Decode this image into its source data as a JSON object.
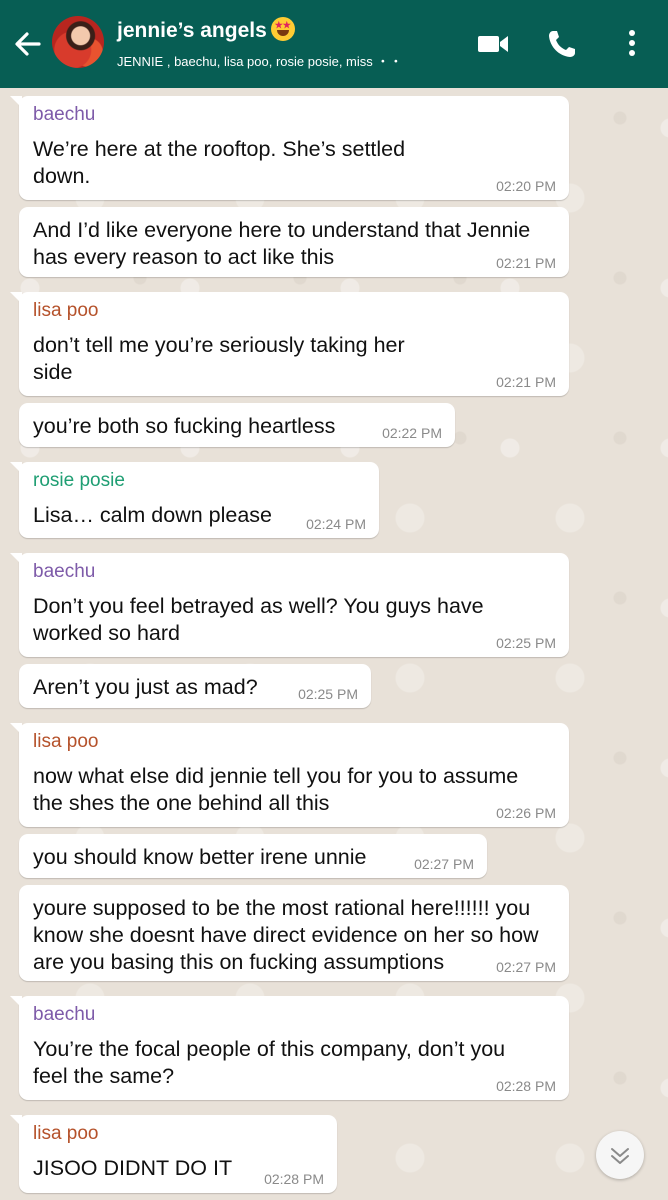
{
  "header": {
    "title": "jennie’s angels",
    "subtitle": "JENNIE , baechu, lisa poo, rosie posie, miss ・・",
    "bg_color": "#075e54",
    "icons": [
      "back-arrow-icon",
      "video-call-icon",
      "voice-call-icon",
      "more-options-icon"
    ]
  },
  "sender_colors": {
    "baechu": "#7e5ba9",
    "lisa poo": "#b5522b",
    "rosie posie": "#1f9e73"
  },
  "messages": [
    {
      "sender": "baechu",
      "lines": [
        "We’re here at the rooftop. She’s settled",
        "down."
      ],
      "time": "02:20 PM"
    },
    {
      "sender": "",
      "lines": [
        "And I’d like everyone here to understand that Jennie",
        "has every reason to act like this"
      ],
      "time": "02:21 PM"
    },
    {
      "sender": "lisa poo",
      "lines": [
        "don’t tell me you’re seriously taking her",
        "side"
      ],
      "time": "02:21 PM"
    },
    {
      "sender": "",
      "lines": [
        "you’re both so fucking heartless"
      ],
      "time": "02:22 PM"
    },
    {
      "sender": "rosie posie",
      "lines": [
        "Lisa… calm down please"
      ],
      "time": "02:24 PM"
    },
    {
      "sender": "baechu",
      "lines": [
        "Don’t you feel betrayed as well? You guys have",
        "worked so hard"
      ],
      "time": "02:25 PM"
    },
    {
      "sender": "",
      "lines": [
        "Aren’t you just as mad?"
      ],
      "time": "02:25 PM"
    },
    {
      "sender": "lisa poo",
      "lines": [
        "now what else did jennie tell you for you to assume",
        "the shes the one behind all this"
      ],
      "time": "02:26 PM"
    },
    {
      "sender": "",
      "lines": [
        "you should know better irene unnie"
      ],
      "time": "02:27 PM"
    },
    {
      "sender": "",
      "lines": [
        "youre supposed to be the most rational here!!!!!! you",
        "know she doesnt have direct evidence on her so how",
        "are you basing this on fucking assumptions"
      ],
      "time": "02:27 PM"
    },
    {
      "sender": "baechu",
      "lines": [
        "You’re the focal people of this company, don’t you",
        "feel the same?"
      ],
      "time": "02:28 PM"
    },
    {
      "sender": "lisa poo",
      "lines": [
        "JISOO DIDNT DO IT"
      ],
      "time": "02:28 PM"
    }
  ]
}
